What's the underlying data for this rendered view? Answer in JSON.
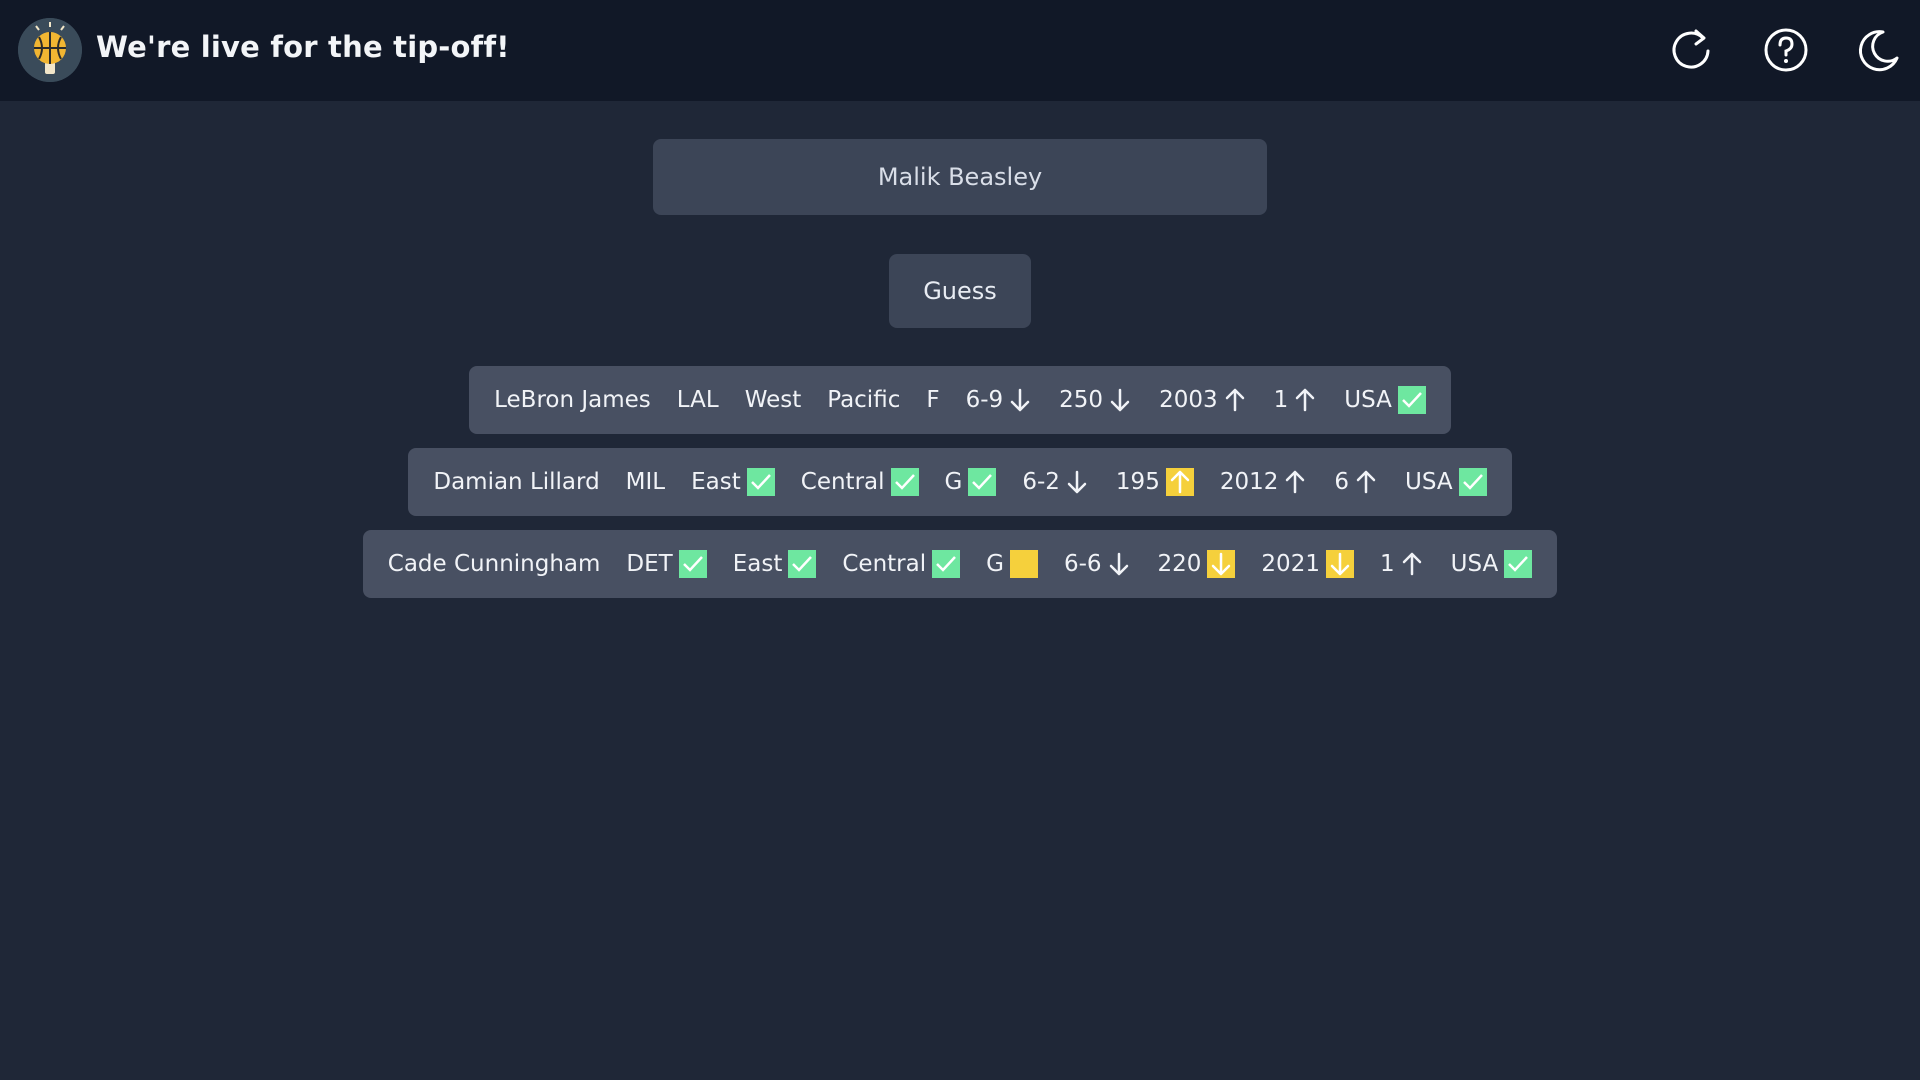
{
  "header": {
    "title": "We're live for the tip-off!",
    "icons": [
      "basketball-logo-icon",
      "refresh-icon",
      "help-icon",
      "moon-icon"
    ]
  },
  "search": {
    "value": "Malik Beasley"
  },
  "guess_button": {
    "label": "Guess"
  },
  "colors": {
    "background": "#1f2737",
    "topbar": "#111827",
    "row": "#485062",
    "correct": "#6ee7a0",
    "close": "#f5d03c"
  },
  "guesses": [
    {
      "name": "LeBron James",
      "cells": [
        {
          "text": "LAL",
          "badge": "none",
          "arrow": "none"
        },
        {
          "text": "West",
          "badge": "none",
          "arrow": "none"
        },
        {
          "text": "Pacific",
          "badge": "none",
          "arrow": "none"
        },
        {
          "text": "F",
          "badge": "none",
          "arrow": "none"
        },
        {
          "text": "6-9",
          "badge": "none",
          "arrow": "down"
        },
        {
          "text": "250",
          "badge": "none",
          "arrow": "down"
        },
        {
          "text": "2003",
          "badge": "none",
          "arrow": "up"
        },
        {
          "text": "1",
          "badge": "none",
          "arrow": "up"
        },
        {
          "text": "USA",
          "badge": "correct",
          "arrow": "check"
        }
      ]
    },
    {
      "name": "Damian Lillard",
      "cells": [
        {
          "text": "MIL",
          "badge": "none",
          "arrow": "none"
        },
        {
          "text": "East",
          "badge": "correct",
          "arrow": "check"
        },
        {
          "text": "Central",
          "badge": "correct",
          "arrow": "check"
        },
        {
          "text": "G",
          "badge": "correct",
          "arrow": "check"
        },
        {
          "text": "6-2",
          "badge": "none",
          "arrow": "down"
        },
        {
          "text": "195",
          "badge": "close",
          "arrow": "up"
        },
        {
          "text": "2012",
          "badge": "none",
          "arrow": "up"
        },
        {
          "text": "6",
          "badge": "none",
          "arrow": "up"
        },
        {
          "text": "USA",
          "badge": "correct",
          "arrow": "check"
        }
      ]
    },
    {
      "name": "Cade Cunningham",
      "cells": [
        {
          "text": "DET",
          "badge": "correct",
          "arrow": "check"
        },
        {
          "text": "East",
          "badge": "correct",
          "arrow": "check"
        },
        {
          "text": "Central",
          "badge": "correct",
          "arrow": "check"
        },
        {
          "text": "G",
          "badge": "close",
          "arrow": "none"
        },
        {
          "text": "6-6",
          "badge": "none",
          "arrow": "down"
        },
        {
          "text": "220",
          "badge": "close",
          "arrow": "down"
        },
        {
          "text": "2021",
          "badge": "close",
          "arrow": "down"
        },
        {
          "text": "1",
          "badge": "none",
          "arrow": "up"
        },
        {
          "text": "USA",
          "badge": "correct",
          "arrow": "check"
        }
      ]
    }
  ]
}
